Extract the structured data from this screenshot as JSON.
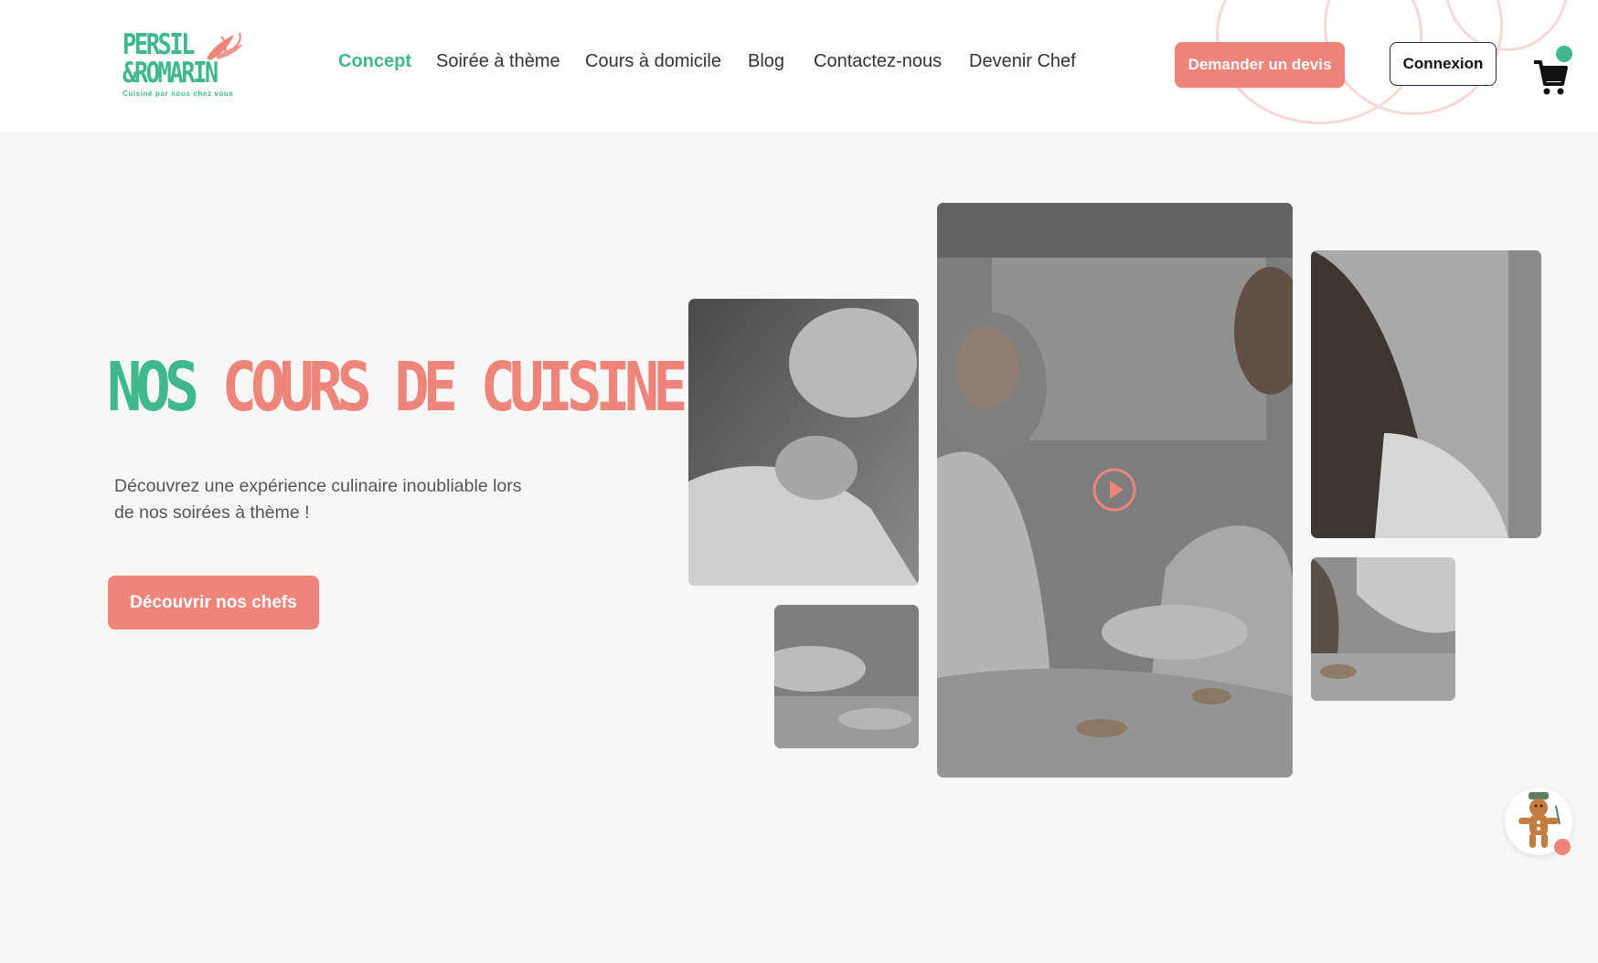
{
  "brand": {
    "line1": "PERSIL",
    "line2": "&ROMARIN",
    "tagline": "Cuisiné par nous chez vous",
    "green": "#3fb88b",
    "coral": "#ee857b"
  },
  "nav": {
    "items": [
      {
        "label": "Concept",
        "active": true
      },
      {
        "label": "Soirée à thème",
        "active": false
      },
      {
        "label": "Cours à domicile",
        "active": false
      },
      {
        "label": "Blog",
        "active": false
      },
      {
        "label": "Contactez-nous",
        "active": false
      },
      {
        "label": "Devenir Chef",
        "active": false
      }
    ]
  },
  "header": {
    "quote_button": "Demander un devis",
    "login_button": "Connexion",
    "cart_icon": "shopping-cart-icon"
  },
  "hero": {
    "title_part1": "NOS",
    "title_part2": "COURS DE CUISINE",
    "subtitle": "Découvrez une expérience culinaire inoubliable lors de nos soirées à thème !",
    "cta": "Découvrir nos chefs",
    "play_icon": "play-icon"
  },
  "chat": {
    "icon": "gingerbread-chef-icon"
  }
}
